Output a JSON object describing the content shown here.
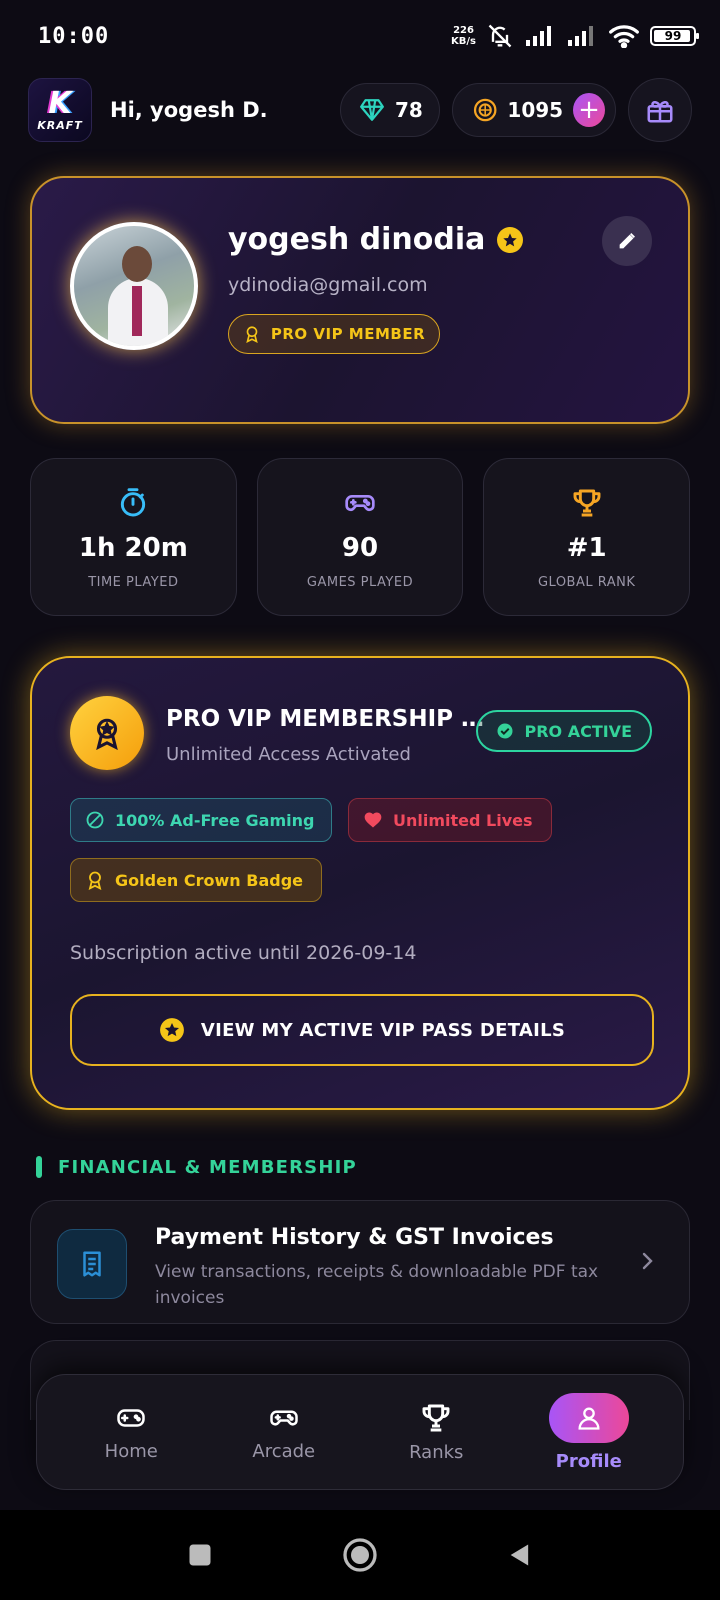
{
  "status_bar": {
    "time": "10:00",
    "net_speed_value": "226",
    "net_speed_unit": "KB/s",
    "battery": "99"
  },
  "header": {
    "logo_letter": "K",
    "logo_text": "KRAFT",
    "greeting": "Hi, yogesh D.",
    "gems": "78",
    "coins": "1095",
    "plus": "+"
  },
  "profile": {
    "name": "yogesh dinodia",
    "email": "ydinodia@gmail.com",
    "membership_chip": "PRO VIP MEMBER"
  },
  "stats": [
    {
      "value": "1h 20m",
      "label": "TIME PLAYED",
      "icon": "stopwatch-icon",
      "color": "#38bdf8"
    },
    {
      "value": "90",
      "label": "GAMES PLAYED",
      "icon": "gamepad-icon",
      "color": "#a78bfa"
    },
    {
      "value": "#1",
      "label": "GLOBAL RANK",
      "icon": "trophy-icon",
      "color": "#f5a524"
    }
  ],
  "vip": {
    "title": "PRO VIP MEMBERSHIP ...",
    "subtitle": "Unlimited Access Activated",
    "status_badge": "PRO ACTIVE",
    "features": [
      "100% Ad-Free Gaming",
      "Unlimited Lives",
      "Golden Crown Badge"
    ],
    "subscription_text": "Subscription active until 2026-09-14",
    "button_label": "VIEW MY ACTIVE VIP PASS DETAILS"
  },
  "financial": {
    "section_title": "FINANCIAL & MEMBERSHIP",
    "items": [
      {
        "title": "Payment History & GST Invoices",
        "subtitle": "View transactions, receipts & downloadable PDF tax invoices"
      }
    ]
  },
  "bottom_nav": {
    "items": [
      {
        "label": "Home",
        "icon": "gamepad-icon"
      },
      {
        "label": "Arcade",
        "icon": "joystick-icon"
      },
      {
        "label": "Ranks",
        "icon": "trophy-icon"
      },
      {
        "label": "Profile",
        "icon": "user-icon"
      }
    ],
    "active": "Profile"
  },
  "colors": {
    "background": "#0d0b14",
    "gold": "#e7b21f",
    "green": "#34d399",
    "purple": "#a78bfa",
    "pink": "#ec4899"
  }
}
